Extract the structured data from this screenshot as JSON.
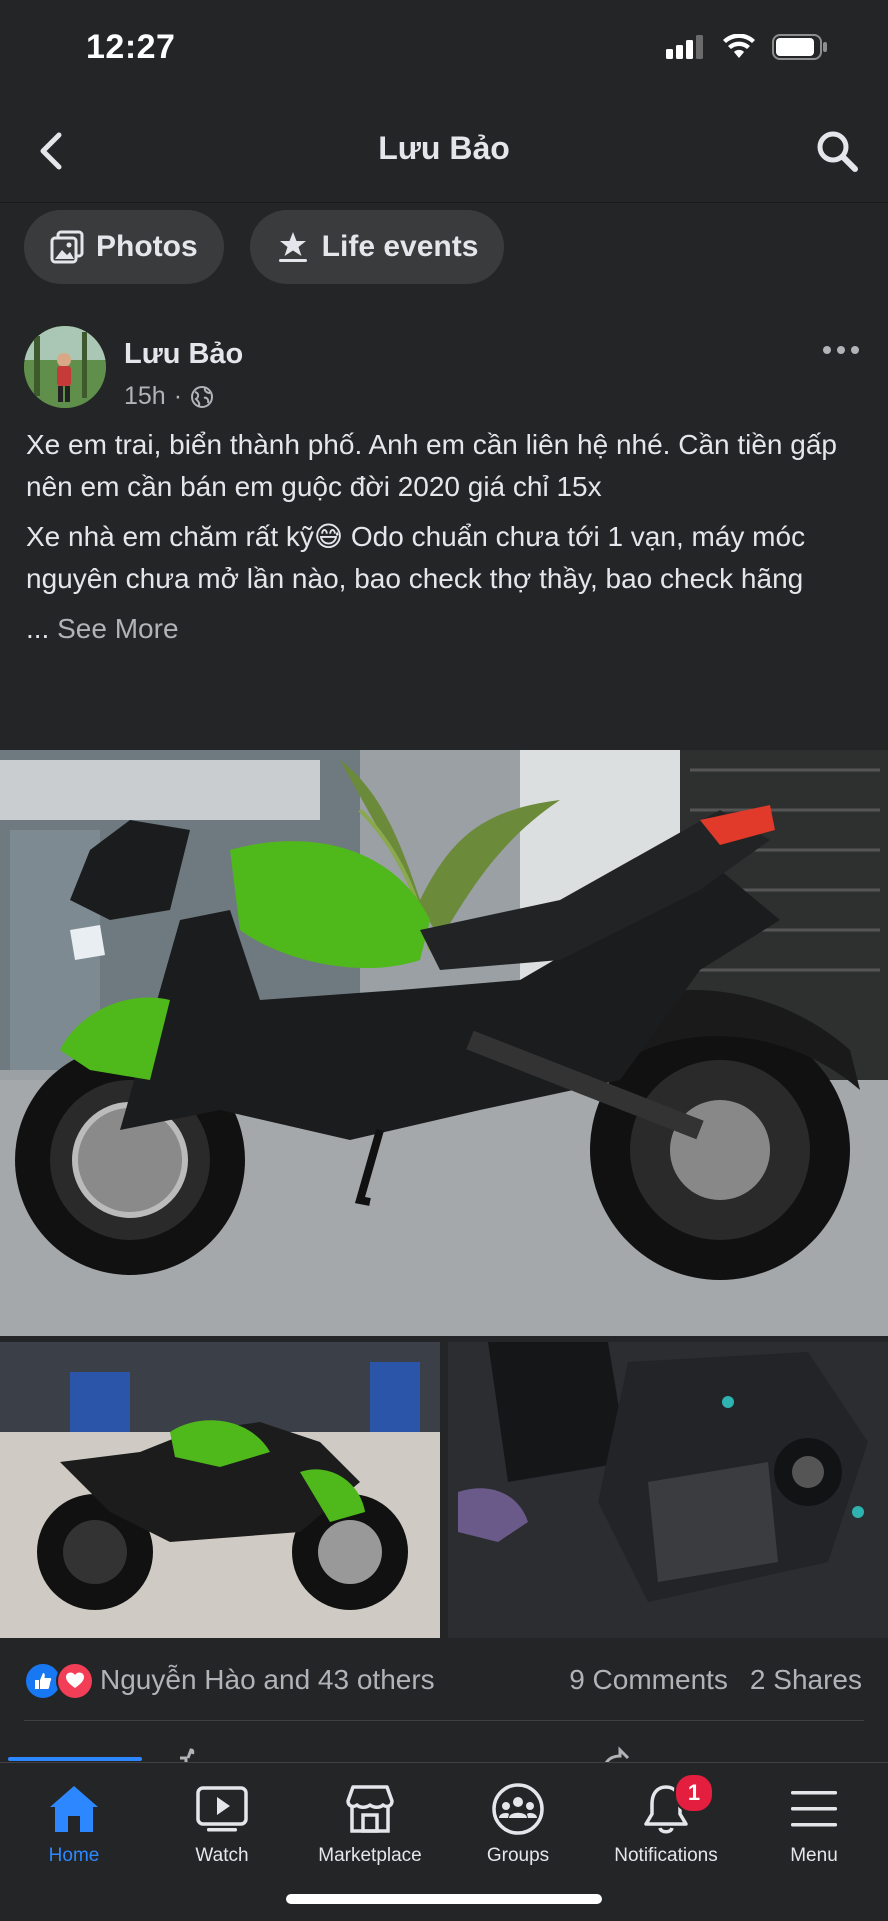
{
  "status": {
    "time": "12:27"
  },
  "header": {
    "title": "Lưu Bảo"
  },
  "chips": [
    {
      "label": "Photos",
      "icon": "photos-icon"
    },
    {
      "label": "Life events",
      "icon": "star-flag-icon"
    }
  ],
  "post": {
    "author": "Lưu Bảo",
    "time": "15h",
    "separator": "·",
    "privacy_icon": "globe-icon",
    "paragraphs": [
      "Xe em trai, biển thành phố. Anh em cần liên hệ nhé. Cần tiền gấp nên em cần bán em guộc đời 2020 giá chỉ 15x",
      "Xe nhà em chăm rất kỹ😅 Odo chuẩn chưa tới 1 vạn, máy móc nguyên chưa mở lần nào, bao check thợ thầy, bao check hãng"
    ],
    "ellipsis": "...",
    "see_more": "See More",
    "reactions": {
      "types": [
        "like",
        "love"
      ],
      "names": "Nguyễn Hào and 43 others",
      "comments": "9 Comments",
      "shares": "2 Shares"
    }
  },
  "colors": {
    "background": "#242526",
    "accent": "#2d88ff",
    "badge": "#e41e3f",
    "kawasaki_green": "#4fb81b"
  },
  "bottom_nav": [
    {
      "label": "Home",
      "icon": "home-icon",
      "active": true
    },
    {
      "label": "Watch",
      "icon": "watch-icon"
    },
    {
      "label": "Marketplace",
      "icon": "marketplace-icon"
    },
    {
      "label": "Groups",
      "icon": "groups-icon"
    },
    {
      "label": "Notifications",
      "icon": "bell-icon",
      "badge": "1"
    },
    {
      "label": "Menu",
      "icon": "menu-icon"
    }
  ]
}
